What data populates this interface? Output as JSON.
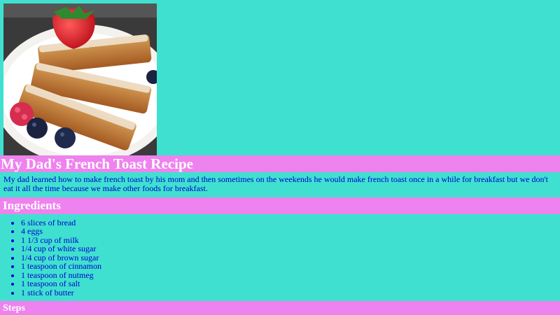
{
  "page": {
    "title": "My Dad's French Toast Recipe",
    "intro": "My dad learned how to make french toast by his mom and then sometimes on the weekends he would make french toast once in a while for breakfast but we don't eat it all the time because we make other foods for breakfast."
  },
  "ingredients": {
    "heading": "Ingredients",
    "items": [
      "6 slices of bread",
      "4 eggs",
      "1 1/3 cup of milk",
      "1/4 cup of white sugar",
      "1/4 cup of brown sugar",
      "1 teaspoon of cinnamon",
      "1 teaspoon of nutmeg",
      "1 teaspoon of salt",
      "1 stick of butter"
    ]
  },
  "steps": {
    "heading": "Steps"
  },
  "colors": {
    "background": "#40e0d0",
    "bar": "#ee82ee",
    "heading_text": "#ffffff",
    "body_text": "#0000cd"
  }
}
